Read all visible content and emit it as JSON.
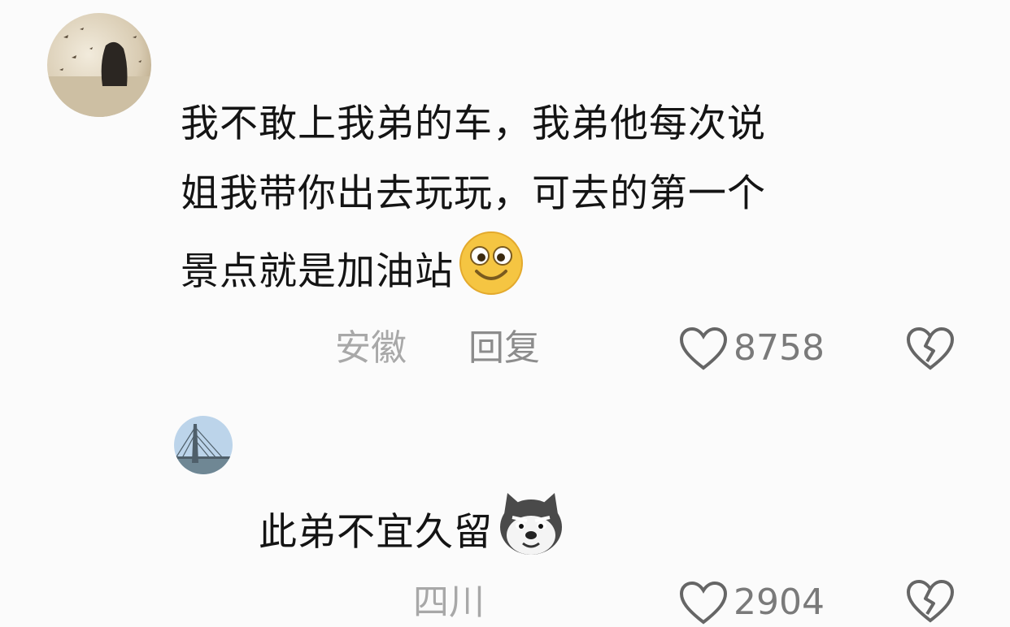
{
  "comments": [
    {
      "text_lines": [
        "我不敢上我弟的车，我弟他每次说",
        "姐我带你出去玩玩，可去的第一个",
        "景点就是加油站"
      ],
      "emoji": "smiling-face-emoji",
      "location": "安徽",
      "reply_label": "回复",
      "likes": "8758",
      "like_icon": "heart-icon",
      "dislike_icon": "broken-heart-icon"
    },
    {
      "text_lines": [
        "此弟不宜久留"
      ],
      "emoji": "husky-dog-emoji",
      "location": "四川",
      "likes": "2904",
      "like_icon": "heart-icon",
      "dislike_icon": "broken-heart-icon"
    }
  ],
  "colors": {
    "background": "#fbfbfb",
    "text": "#141414",
    "meta": "#a8a8a8",
    "emoji_yellow": "#f5c542"
  }
}
